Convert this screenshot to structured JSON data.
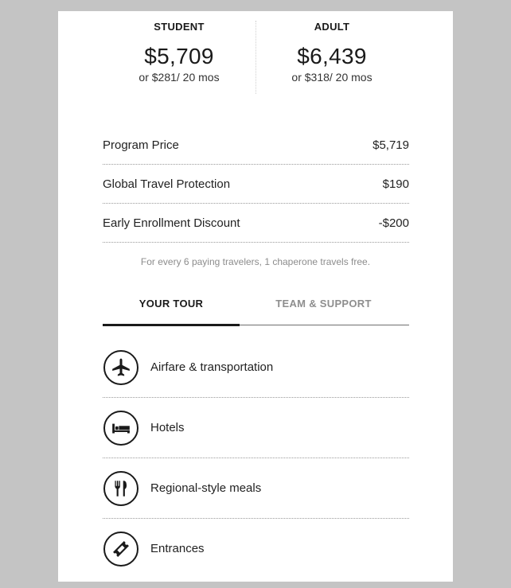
{
  "pricing": {
    "student": {
      "label": "STUDENT",
      "amount": "$5,709",
      "monthly": "or $281/ 20 mos"
    },
    "adult": {
      "label": "ADULT",
      "amount": "$6,439",
      "monthly": "or $318/ 20 mos"
    }
  },
  "line_items": [
    {
      "label": "Program Price",
      "value": "$5,719"
    },
    {
      "label": "Global Travel Protection",
      "value": "$190"
    },
    {
      "label": "Early Enrollment Discount",
      "value": "-$200"
    }
  ],
  "note": "For every 6 paying travelers, 1 chaperone travels free.",
  "tabs": [
    {
      "label": "YOUR TOUR",
      "active": true
    },
    {
      "label": "TEAM & SUPPORT",
      "active": false
    }
  ],
  "features": [
    {
      "label": "Airfare & transportation",
      "icon": "airplane-icon"
    },
    {
      "label": "Hotels",
      "icon": "bed-icon"
    },
    {
      "label": "Regional-style meals",
      "icon": "utensils-icon"
    },
    {
      "label": "Entrances",
      "icon": "ticket-icon"
    }
  ]
}
